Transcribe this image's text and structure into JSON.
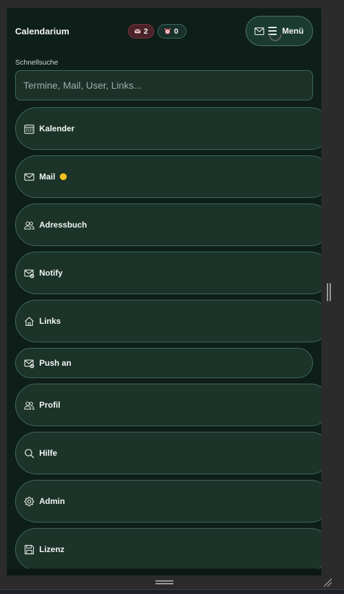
{
  "header": {
    "title": "Calendarium",
    "mail_badge": {
      "icon": "envelope-icon",
      "count": "2"
    },
    "alarm_badge": {
      "icon": "alarm-clock-icon",
      "count": "0"
    },
    "menu_button": {
      "icon": "envelope-icon",
      "label": "Menü"
    }
  },
  "search": {
    "label": "Schnellsuche",
    "placeholder": "Termine, Mail, User, Links..."
  },
  "nav": {
    "items": [
      {
        "label": "Kalender",
        "icon": "calendar-icon"
      },
      {
        "label": "Mail",
        "icon": "envelope-icon",
        "indicator": "unread-dot"
      },
      {
        "label": "Adressbuch",
        "icon": "users-icon"
      },
      {
        "label": "Notify",
        "icon": "envelope-check-icon"
      },
      {
        "label": "Links",
        "icon": "home-icon"
      },
      {
        "label": "Push an",
        "icon": "envelope-check-icon"
      },
      {
        "label": "Profil",
        "icon": "users-icon"
      },
      {
        "label": "Hilfe",
        "icon": "search-icon"
      },
      {
        "label": "Admin",
        "icon": "gear-icon"
      },
      {
        "label": "Lizenz",
        "icon": "save-icon"
      }
    ]
  },
  "colors": {
    "background": "#0e1e19",
    "item_fill": "#1c3329",
    "item_border": "#3f6a5c",
    "mail_badge": "#4a2329",
    "unread_dot": "#f3c41f"
  }
}
